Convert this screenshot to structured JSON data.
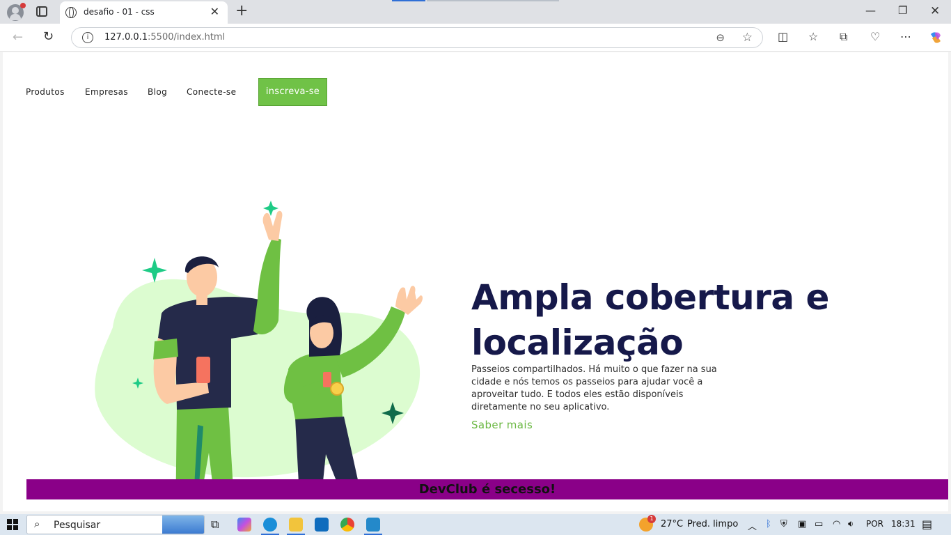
{
  "browser": {
    "tab_title": "desafio - 01 - css",
    "url_host": "127.0.0.1",
    "url_path": ":5500/index.html"
  },
  "nav": {
    "items": [
      {
        "label": "Produtos"
      },
      {
        "label": "Empresas"
      },
      {
        "label": "Blog"
      },
      {
        "label": "Conecte-se"
      }
    ],
    "signup_label": "inscreva-se"
  },
  "hero": {
    "headline_line1": "Ampla cobertura e",
    "headline_line2": "localização",
    "paragraph": "Passeios compartilhados. Há muito o que fazer na sua cidade e nós temos os passeios para ajudar você a aproveitar tudo. E todos eles estão disponíveis diretamente no seu aplicativo.",
    "link_label": "Saber mais"
  },
  "banner": {
    "text": "DevClub é secesso!"
  },
  "taskbar": {
    "search_placeholder": "Pesquisar",
    "weather_badge": "1",
    "temperature": "27°C",
    "weather": "Pred. limpo",
    "language": "POR",
    "time": "18:31"
  },
  "colors": {
    "accent_green": "#70c247",
    "headline_navy": "#16194a",
    "banner_purple": "#8a0088"
  }
}
